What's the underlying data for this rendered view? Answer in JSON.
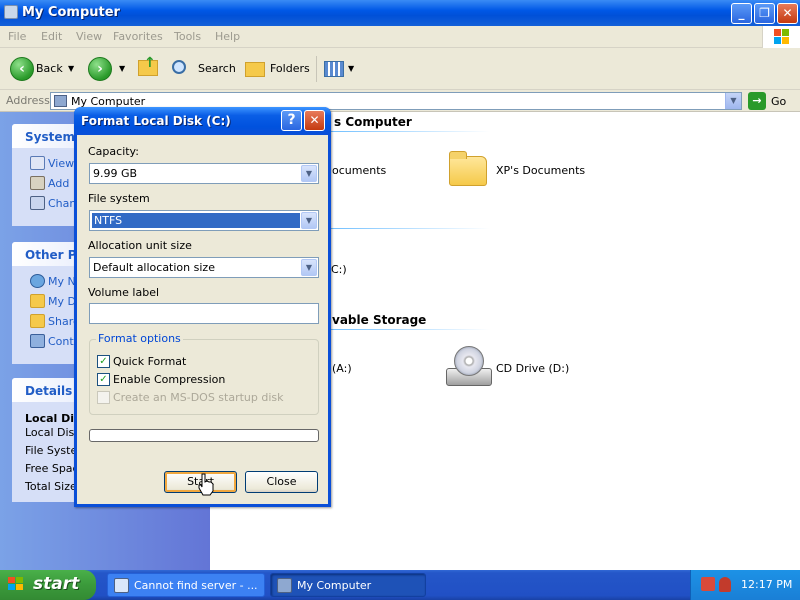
{
  "window": {
    "title": "My Computer",
    "controls": {
      "minimize": "_",
      "restore": "❐",
      "close": "✕"
    }
  },
  "menu": [
    "File",
    "Edit",
    "View",
    "Favorites",
    "Tools",
    "Help"
  ],
  "toolbar": {
    "back": "Back",
    "search": "Search",
    "folders": "Folders"
  },
  "address": {
    "label": "Address",
    "value": "My Computer",
    "go": "Go"
  },
  "sidebar": {
    "system_tasks": {
      "title": "System",
      "items": [
        "View",
        "Add",
        "Chan"
      ]
    },
    "other_places": {
      "title": "Other Pla",
      "items": [
        "My Ne",
        "My Do",
        "Share",
        "Contr"
      ]
    },
    "details": {
      "title": "Details",
      "lines": [
        "Local Dis",
        "Local Disk",
        "File Syste",
        "Free Spac",
        "Total Size"
      ]
    }
  },
  "content": {
    "section1": "s Computer",
    "item_documents_partial": "ocuments",
    "xp_documents": "XP's Documents",
    "drive_partial": "C:)",
    "section2": "vable Storage",
    "floppy_partial": "(A:)",
    "cd_drive": "CD Drive (D:)"
  },
  "dialog": {
    "title": "Format Local Disk (C:)",
    "help": "?",
    "close": "✕",
    "capacity_label": "Capacity:",
    "capacity_value": "9.99 GB",
    "filesystem_label": "File system",
    "filesystem_value": "NTFS",
    "alloc_label": "Allocation unit size",
    "alloc_value": "Default allocation size",
    "volume_label": "Volume label",
    "volume_value": "",
    "options_label": "Format options",
    "quick_format": "Quick Format",
    "quick_format_checked": true,
    "enable_compression": "Enable Compression",
    "enable_compression_checked": true,
    "msdos_disk": "Create an MS-DOS startup disk",
    "msdos_disk_checked": false,
    "progress": 0,
    "start_button": "Start",
    "close_button": "Close"
  },
  "taskbar": {
    "start": "start",
    "tasks": [
      "Cannot find server - ...",
      "My Computer"
    ],
    "clock": "12:17 PM"
  },
  "colors": {
    "xp_blue": "#0058e6",
    "task_pane": "#6375d6",
    "start_green": "#3b9a3b",
    "selection": "#316ac5"
  }
}
